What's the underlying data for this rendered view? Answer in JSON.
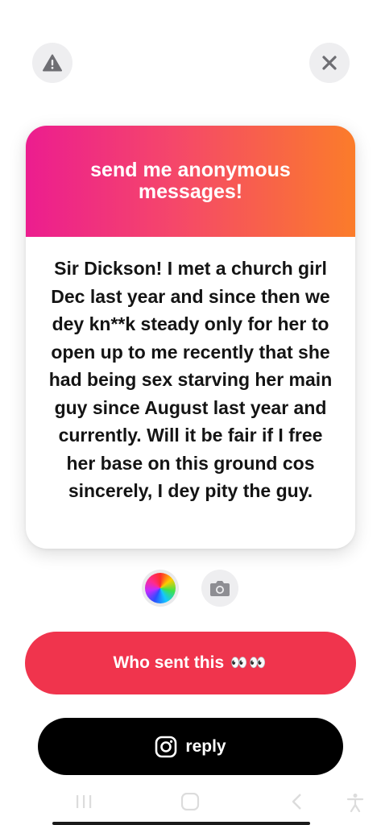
{
  "header": {
    "report_icon": "warning-icon",
    "close_icon": "close-icon"
  },
  "card": {
    "title": "send me anonymous messages!",
    "message": "Sir Dickson! I met a church girl Dec last year and since then we dey kn**k steady only for her to open up to me recently that she had being sex starving her main guy since August last year and currently. Will it be fair if I free her base on this ground cos sincerely, I dey pity the guy.",
    "gradient": [
      "#ec1d8f",
      "#fb7c2a"
    ]
  },
  "tools": {
    "color_icon": "color-wheel-icon",
    "camera_icon": "camera-icon"
  },
  "actions": {
    "who_sent_label": "Who sent this",
    "who_sent_emoji": "👀👀",
    "who_sent_color": "#f0344d",
    "reply_label": "reply",
    "reply_icon": "instagram-icon"
  },
  "nav": {
    "items": [
      "recent-apps-icon",
      "home-icon",
      "back-icon",
      "accessibility-icon"
    ]
  }
}
